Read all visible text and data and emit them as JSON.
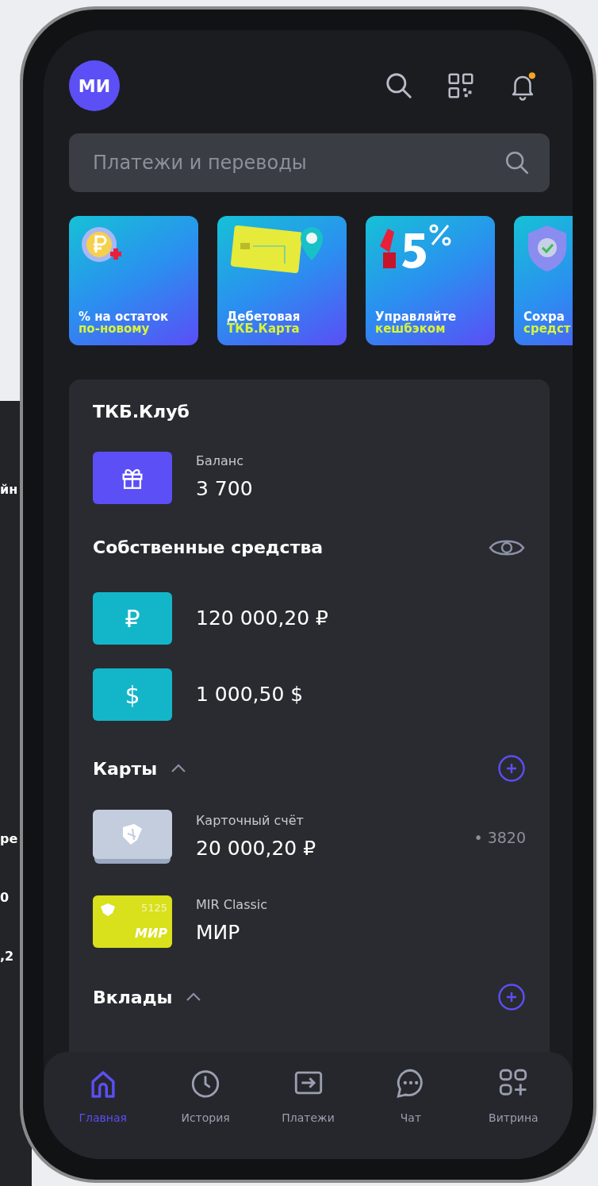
{
  "backdrop_fragments": [
    "йн",
    "ре",
    "0",
    ",2"
  ],
  "header": {
    "avatar_initials": "МИ",
    "has_notification": true
  },
  "search": {
    "placeholder": "Платежи и переводы"
  },
  "promos": [
    {
      "kind": "coin",
      "line1": "% на остаток",
      "line2": "по-новому"
    },
    {
      "kind": "card",
      "line1": "Дебетовая",
      "line2": "ТКБ.Карта"
    },
    {
      "kind": "cashback",
      "line1": "Управляйте",
      "line2": "кешбэком"
    },
    {
      "kind": "shield",
      "line1": "Сохра",
      "line2": "средст"
    }
  ],
  "club": {
    "title": "ТКБ.Клуб",
    "balance_label": "Баланс",
    "balance_value": "3 700"
  },
  "own_funds": {
    "title": "Собственные средства",
    "accounts": [
      {
        "symbol": "₽",
        "amount": "120 000,20 ₽"
      },
      {
        "symbol": "$",
        "amount": "1 000,50 $"
      }
    ]
  },
  "cards": {
    "title": "Карты",
    "expanded": true,
    "items": [
      {
        "kind": "account",
        "name": "Карточный счёт",
        "amount": "20 000,20 ₽",
        "mask": "• 3820"
      },
      {
        "kind": "mir",
        "name": "MIR Classic",
        "amount": "МИР",
        "card_digits": "5125",
        "card_brand": "МИР"
      }
    ]
  },
  "deposits": {
    "title": "Вклады",
    "expanded": true
  },
  "nav": [
    {
      "label": "Главная",
      "selected": true
    },
    {
      "label": "История",
      "selected": false
    },
    {
      "label": "Платежи",
      "selected": false
    },
    {
      "label": "Чат",
      "selected": false
    },
    {
      "label": "Витрина",
      "selected": false
    }
  ]
}
